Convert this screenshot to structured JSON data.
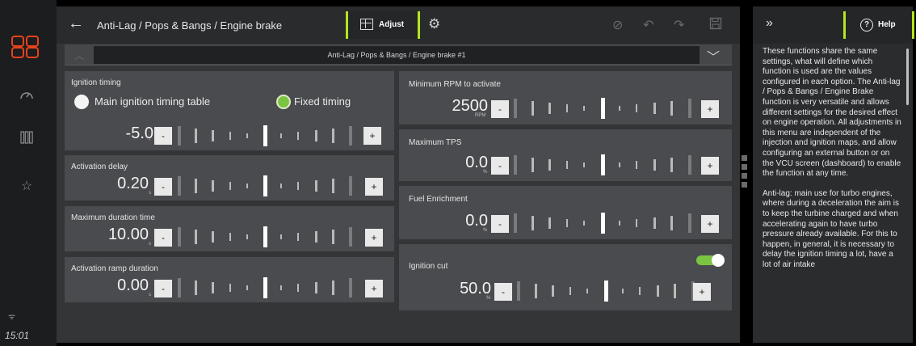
{
  "rail": {
    "time": "15:01"
  },
  "header": {
    "title": "Anti-Lag / Pops & Bangs / Engine brake",
    "adjust_label": "Adjust"
  },
  "selector": {
    "value": "Anti-Lag / Pops & Bangs / Engine brake #1"
  },
  "ignition_timing": {
    "label": "Ignition timing",
    "option_main": "Main ignition timing table",
    "option_fixed": "Fixed timing",
    "selected": "Fixed timing",
    "value": "-5.0",
    "unit": "°"
  },
  "activation_delay": {
    "label": "Activation delay",
    "value": "0.20",
    "unit": "s"
  },
  "max_duration": {
    "label": "Maximum duration time",
    "value": "10.00",
    "unit": "s"
  },
  "ramp_duration": {
    "label": "Activation ramp duration",
    "value": "0.00",
    "unit": "s"
  },
  "min_rpm": {
    "label": "Minimum RPM to activate",
    "value": "2500",
    "unit": "RPM"
  },
  "max_tps": {
    "label": "Maximum TPS",
    "value": "0.0",
    "unit": "%"
  },
  "fuel_enrichment": {
    "label": "Fuel Enrichment",
    "value": "0.0",
    "unit": "%"
  },
  "ignition_cut": {
    "label": "Ignition cut",
    "enabled": true,
    "value": "50.0",
    "unit": "%"
  },
  "controls": {
    "minus": "-",
    "plus": "+"
  },
  "help": {
    "tab_label": "Help",
    "paragraph1": "These functions share the same settings, what will define which function is used are the values configured in each option. The Anti-lag / Pops & Bangs / Engine Brake function is very versatile and allows different settings for the desired effect on engine operation. All adjustments in this menu are independent of the injection and ignition maps, and allow configuring an external button or on the VCU screen (dashboard) to enable the function at any time.",
    "paragraph2": "Anti-lag: main use for turbo engines, where during a deceleration the aim is to keep the turbine charged and when accelerating again to have turbo pressure already available. For this to happen, in general, it is necessary to delay the ignition timing a lot, have a lot of air intake"
  },
  "colors": {
    "accent": "#b5e61d",
    "toggle_on": "#7bc442",
    "logo": "#e8421a"
  }
}
